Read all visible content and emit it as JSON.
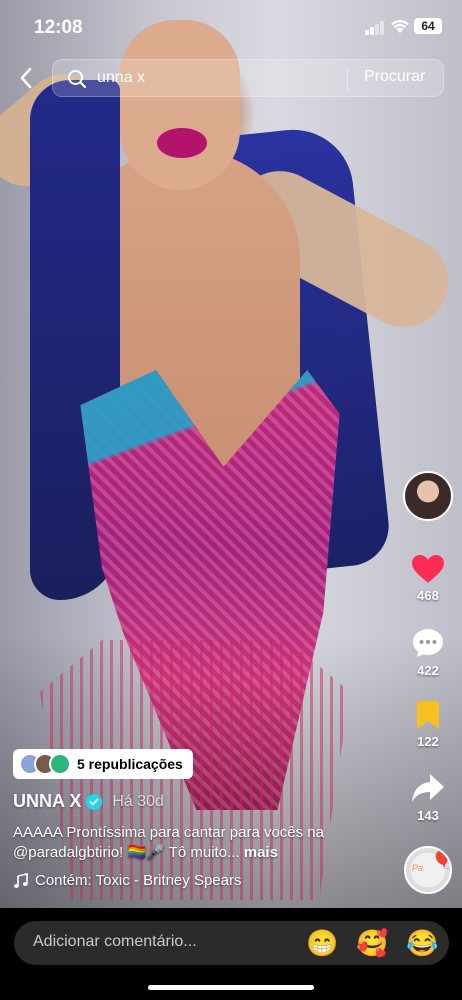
{
  "status_bar": {
    "time": "12:08",
    "battery": "64"
  },
  "search": {
    "query": "unna x",
    "submit_label": "Procurar"
  },
  "rail": {
    "likes": "468",
    "comments": "422",
    "saves": "122",
    "shares": "143"
  },
  "reposts": {
    "label": "5 republicações"
  },
  "author": {
    "username": "UNNA X",
    "time_ago": "Há 30d"
  },
  "caption": {
    "text": "AAAAA Prontíssima para cantar para vocês na @paradalgbtirio! 🏳️‍🌈🎤 Tô muito...",
    "more": "mais"
  },
  "sound": {
    "label": "Contém: Toxic - Britney Spears"
  },
  "comment": {
    "placeholder": "Adicionar comentário..."
  },
  "quick_emojis": [
    "😁",
    "🥰",
    "😂"
  ],
  "colors": {
    "like": "#fe2c55",
    "save": "#f7c021",
    "verified": "#20d5ec"
  }
}
